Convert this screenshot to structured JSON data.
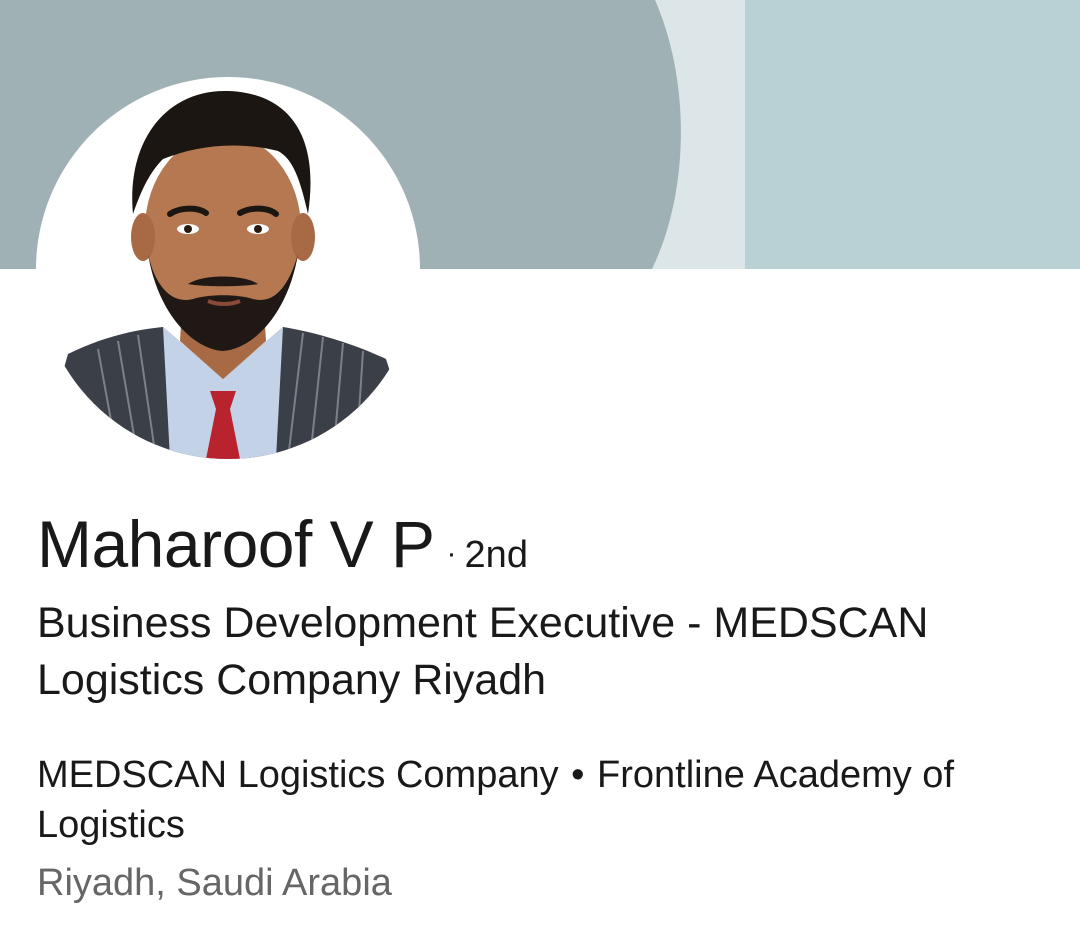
{
  "profile": {
    "name": "Maharoof V P",
    "degree_separator": "·",
    "degree": "2nd",
    "headline": "Business Development Executive - MEDSCAN Logistics Company Riyadh",
    "companies": [
      "MEDSCAN Logistics Company",
      "Frontline Academy of Logistics"
    ],
    "company_separator": "•",
    "location": "Riyadh, Saudi Arabia"
  },
  "banner": {
    "colors": [
      "#9fb1b5",
      "#dce6e8",
      "#b9d0d4"
    ]
  },
  "avatar": {
    "icon": "profile-photo"
  }
}
